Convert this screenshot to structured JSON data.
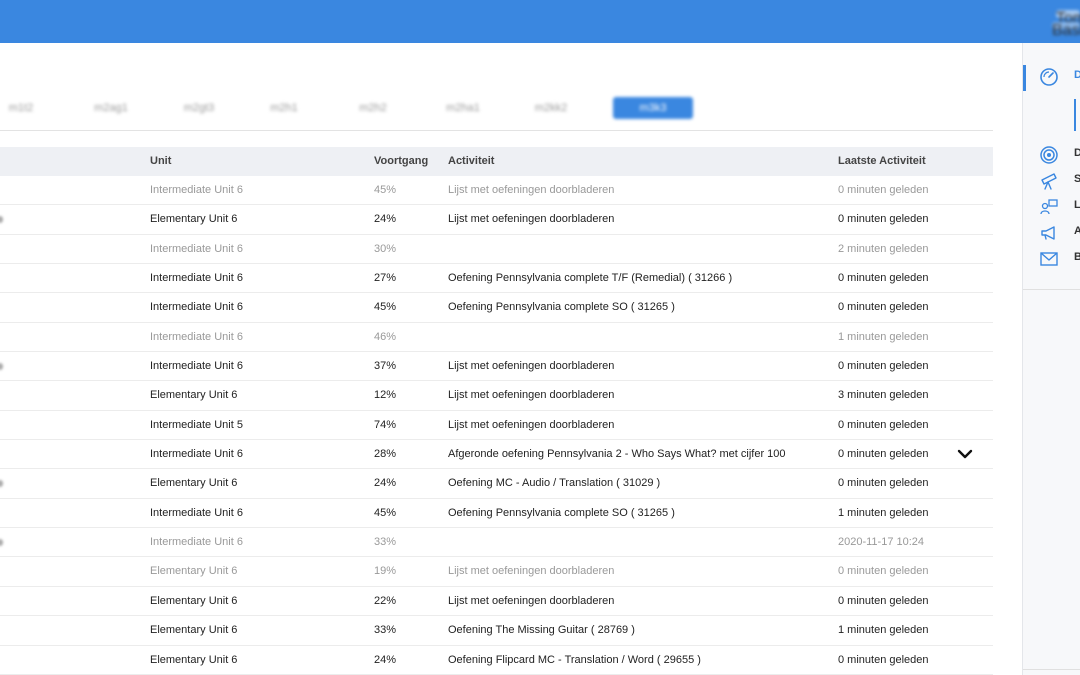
{
  "header": {
    "user_name": "Tom",
    "user_role": "Basic"
  },
  "tabs": [
    {
      "label": "m1t2"
    },
    {
      "label": "m2ag1"
    },
    {
      "label": "m2gt3"
    },
    {
      "label": "m2h1"
    },
    {
      "label": "m2h2"
    },
    {
      "label": "m2ha1"
    },
    {
      "label": "m2kk2"
    },
    {
      "label": "m3k3",
      "active": true
    }
  ],
  "table": {
    "columns": {
      "unit": "Unit",
      "progress": "Voortgang",
      "activity": "Activiteit",
      "last": "Laatste Activiteit"
    },
    "rows": [
      {
        "unit": "Intermediate Unit 6",
        "progress": "45%",
        "activity": "Lijst met oefeningen doorbladeren",
        "last": "0 minuten geleden",
        "faded": true
      },
      {
        "unit": "Elementary Unit 6",
        "progress": "24%",
        "activity": "Lijst met oefeningen doorbladeren",
        "last": "0 minuten geleden",
        "faded": false
      },
      {
        "unit": "Intermediate Unit 6",
        "progress": "30%",
        "activity": "",
        "last": "2 minuten geleden",
        "faded": true
      },
      {
        "unit": "Intermediate Unit 6",
        "progress": "27%",
        "activity": "Oefening Pennsylvania complete T/F (Remedial) ( 31266 )",
        "last": "0 minuten geleden",
        "faded": false
      },
      {
        "unit": "Intermediate Unit 6",
        "progress": "45%",
        "activity": "Oefening Pennsylvania complete SO ( 31265 )",
        "last": "0 minuten geleden",
        "faded": false
      },
      {
        "unit": "Intermediate Unit 6",
        "progress": "46%",
        "activity": "",
        "last": "1 minuten geleden",
        "faded": true
      },
      {
        "unit": "Intermediate Unit 6",
        "progress": "37%",
        "activity": "Lijst met oefeningen doorbladeren",
        "last": "0 minuten geleden",
        "faded": false
      },
      {
        "unit": "Elementary Unit 6",
        "progress": "12%",
        "activity": "Lijst met oefeningen doorbladeren",
        "last": "3 minuten geleden",
        "faded": false
      },
      {
        "unit": "Intermediate Unit 5",
        "progress": "74%",
        "activity": "Lijst met oefeningen doorbladeren",
        "last": "0 minuten geleden",
        "faded": false
      },
      {
        "unit": "Intermediate Unit 6",
        "progress": "28%",
        "activity": "Afgeronde oefening Pennsylvania 2 - Who Says What? met cijfer 100",
        "last": "0 minuten geleden",
        "faded": false,
        "expandable": true
      },
      {
        "unit": "Elementary Unit 6",
        "progress": "24%",
        "activity": "Oefening MC - Audio / Translation ( 31029 )",
        "last": "0 minuten geleden",
        "faded": false
      },
      {
        "unit": "Intermediate Unit 6",
        "progress": "45%",
        "activity": "Oefening Pennsylvania complete SO ( 31265 )",
        "last": "1 minuten geleden",
        "faded": false
      },
      {
        "unit": "Intermediate Unit 6",
        "progress": "33%",
        "activity": "",
        "last": "2020-11-17 10:24",
        "faded": true
      },
      {
        "unit": "Elementary Unit 6",
        "progress": "19%",
        "activity": "Lijst met oefeningen doorbladeren",
        "last": "0 minuten geleden",
        "faded": true
      },
      {
        "unit": "Elementary Unit 6",
        "progress": "22%",
        "activity": "Lijst met oefeningen doorbladeren",
        "last": "0 minuten geleden",
        "faded": false
      },
      {
        "unit": "Elementary Unit 6",
        "progress": "33%",
        "activity": "Oefening The Missing Guitar ( 28769 )",
        "last": "1 minuten geleden",
        "faded": false
      },
      {
        "unit": "Elementary Unit 6",
        "progress": "24%",
        "activity": "Oefening Flipcard MC - Translation / Word ( 29655 )",
        "last": "0 minuten geleden",
        "faded": false
      }
    ]
  },
  "sidebar": {
    "items": [
      {
        "label": "D",
        "icon": "dashboard-icon",
        "active": true
      },
      {
        "label": "D",
        "icon": "target-icon"
      },
      {
        "label": "S",
        "icon": "telescope-icon"
      },
      {
        "label": "L",
        "icon": "students-icon"
      },
      {
        "label": "A",
        "icon": "megaphone-icon"
      },
      {
        "label": "B",
        "icon": "mail-icon"
      }
    ]
  },
  "colors": {
    "accent": "#3a87e0",
    "header_bg": "#eef0f4",
    "faded_text": "#999999"
  }
}
